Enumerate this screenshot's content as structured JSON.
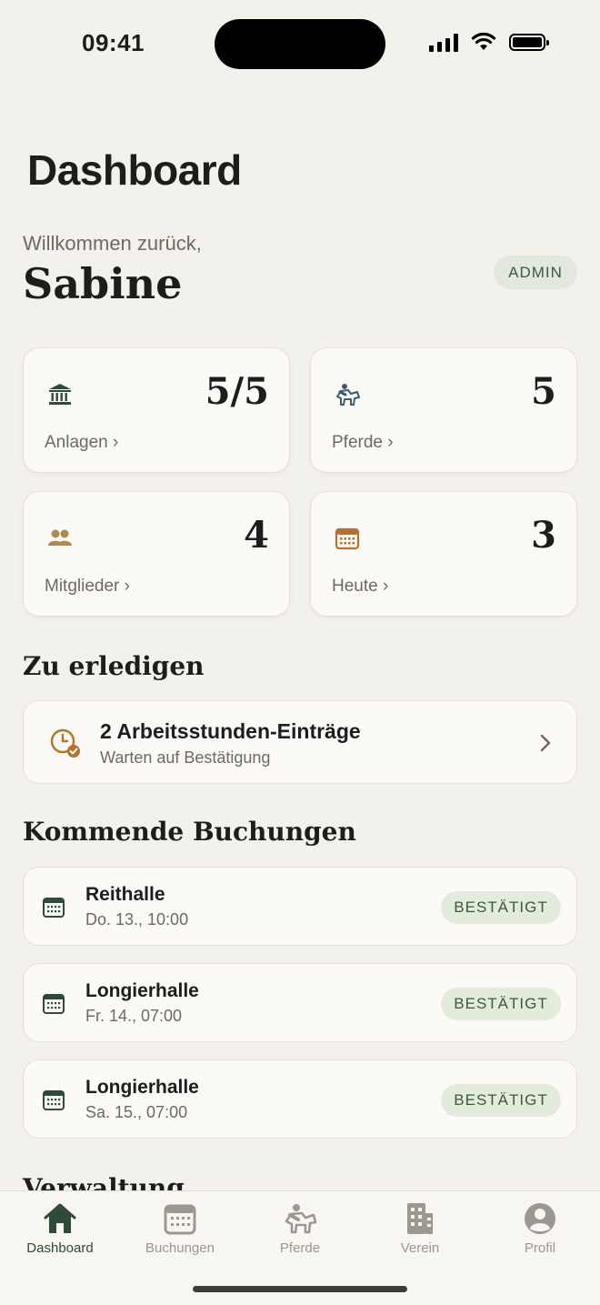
{
  "status_bar": {
    "time": "09:41"
  },
  "page": {
    "title": "Dashboard"
  },
  "greeting": {
    "welcome": "Willkommen zurück,",
    "name": "Sabine",
    "role": "ADMIN"
  },
  "stats": [
    {
      "value": "5/5",
      "label": "Anlagen",
      "icon": "building-columns-icon"
    },
    {
      "value": "5",
      "label": "Pferde",
      "icon": "horse-rider-icon"
    },
    {
      "value": "4",
      "label": "Mitglieder",
      "icon": "people-icon"
    },
    {
      "value": "3",
      "label": "Heute",
      "icon": "calendar-icon"
    }
  ],
  "todo": {
    "section_title": "Zu erledigen",
    "title": "2 Arbeitsstunden-Einträge",
    "subtitle": "Warten auf Bestätigung"
  },
  "bookings": {
    "section_title": "Kommende Buchungen",
    "items": [
      {
        "name": "Reithalle",
        "time": "Do. 13., 10:00",
        "status": "BESTÄTIGT"
      },
      {
        "name": "Longierhalle",
        "time": "Fr. 14., 07:00",
        "status": "BESTÄTIGT"
      },
      {
        "name": "Longierhalle",
        "time": "Sa. 15., 07:00",
        "status": "BESTÄTIGT"
      }
    ]
  },
  "admin_section": {
    "title": "Verwaltung"
  },
  "tabs": [
    {
      "label": "Dashboard",
      "icon": "home-icon",
      "active": true
    },
    {
      "label": "Buchungen",
      "icon": "calendar-icon"
    },
    {
      "label": "Pferde",
      "icon": "horse-rider-icon"
    },
    {
      "label": "Verein",
      "icon": "building-icon"
    },
    {
      "label": "Profil",
      "icon": "person-circle-icon"
    }
  ],
  "colors": {
    "background": "#f3f1eb",
    "accent": "#2f4a36",
    "orange": "#b5722c",
    "badge": "#e2ebdc"
  }
}
